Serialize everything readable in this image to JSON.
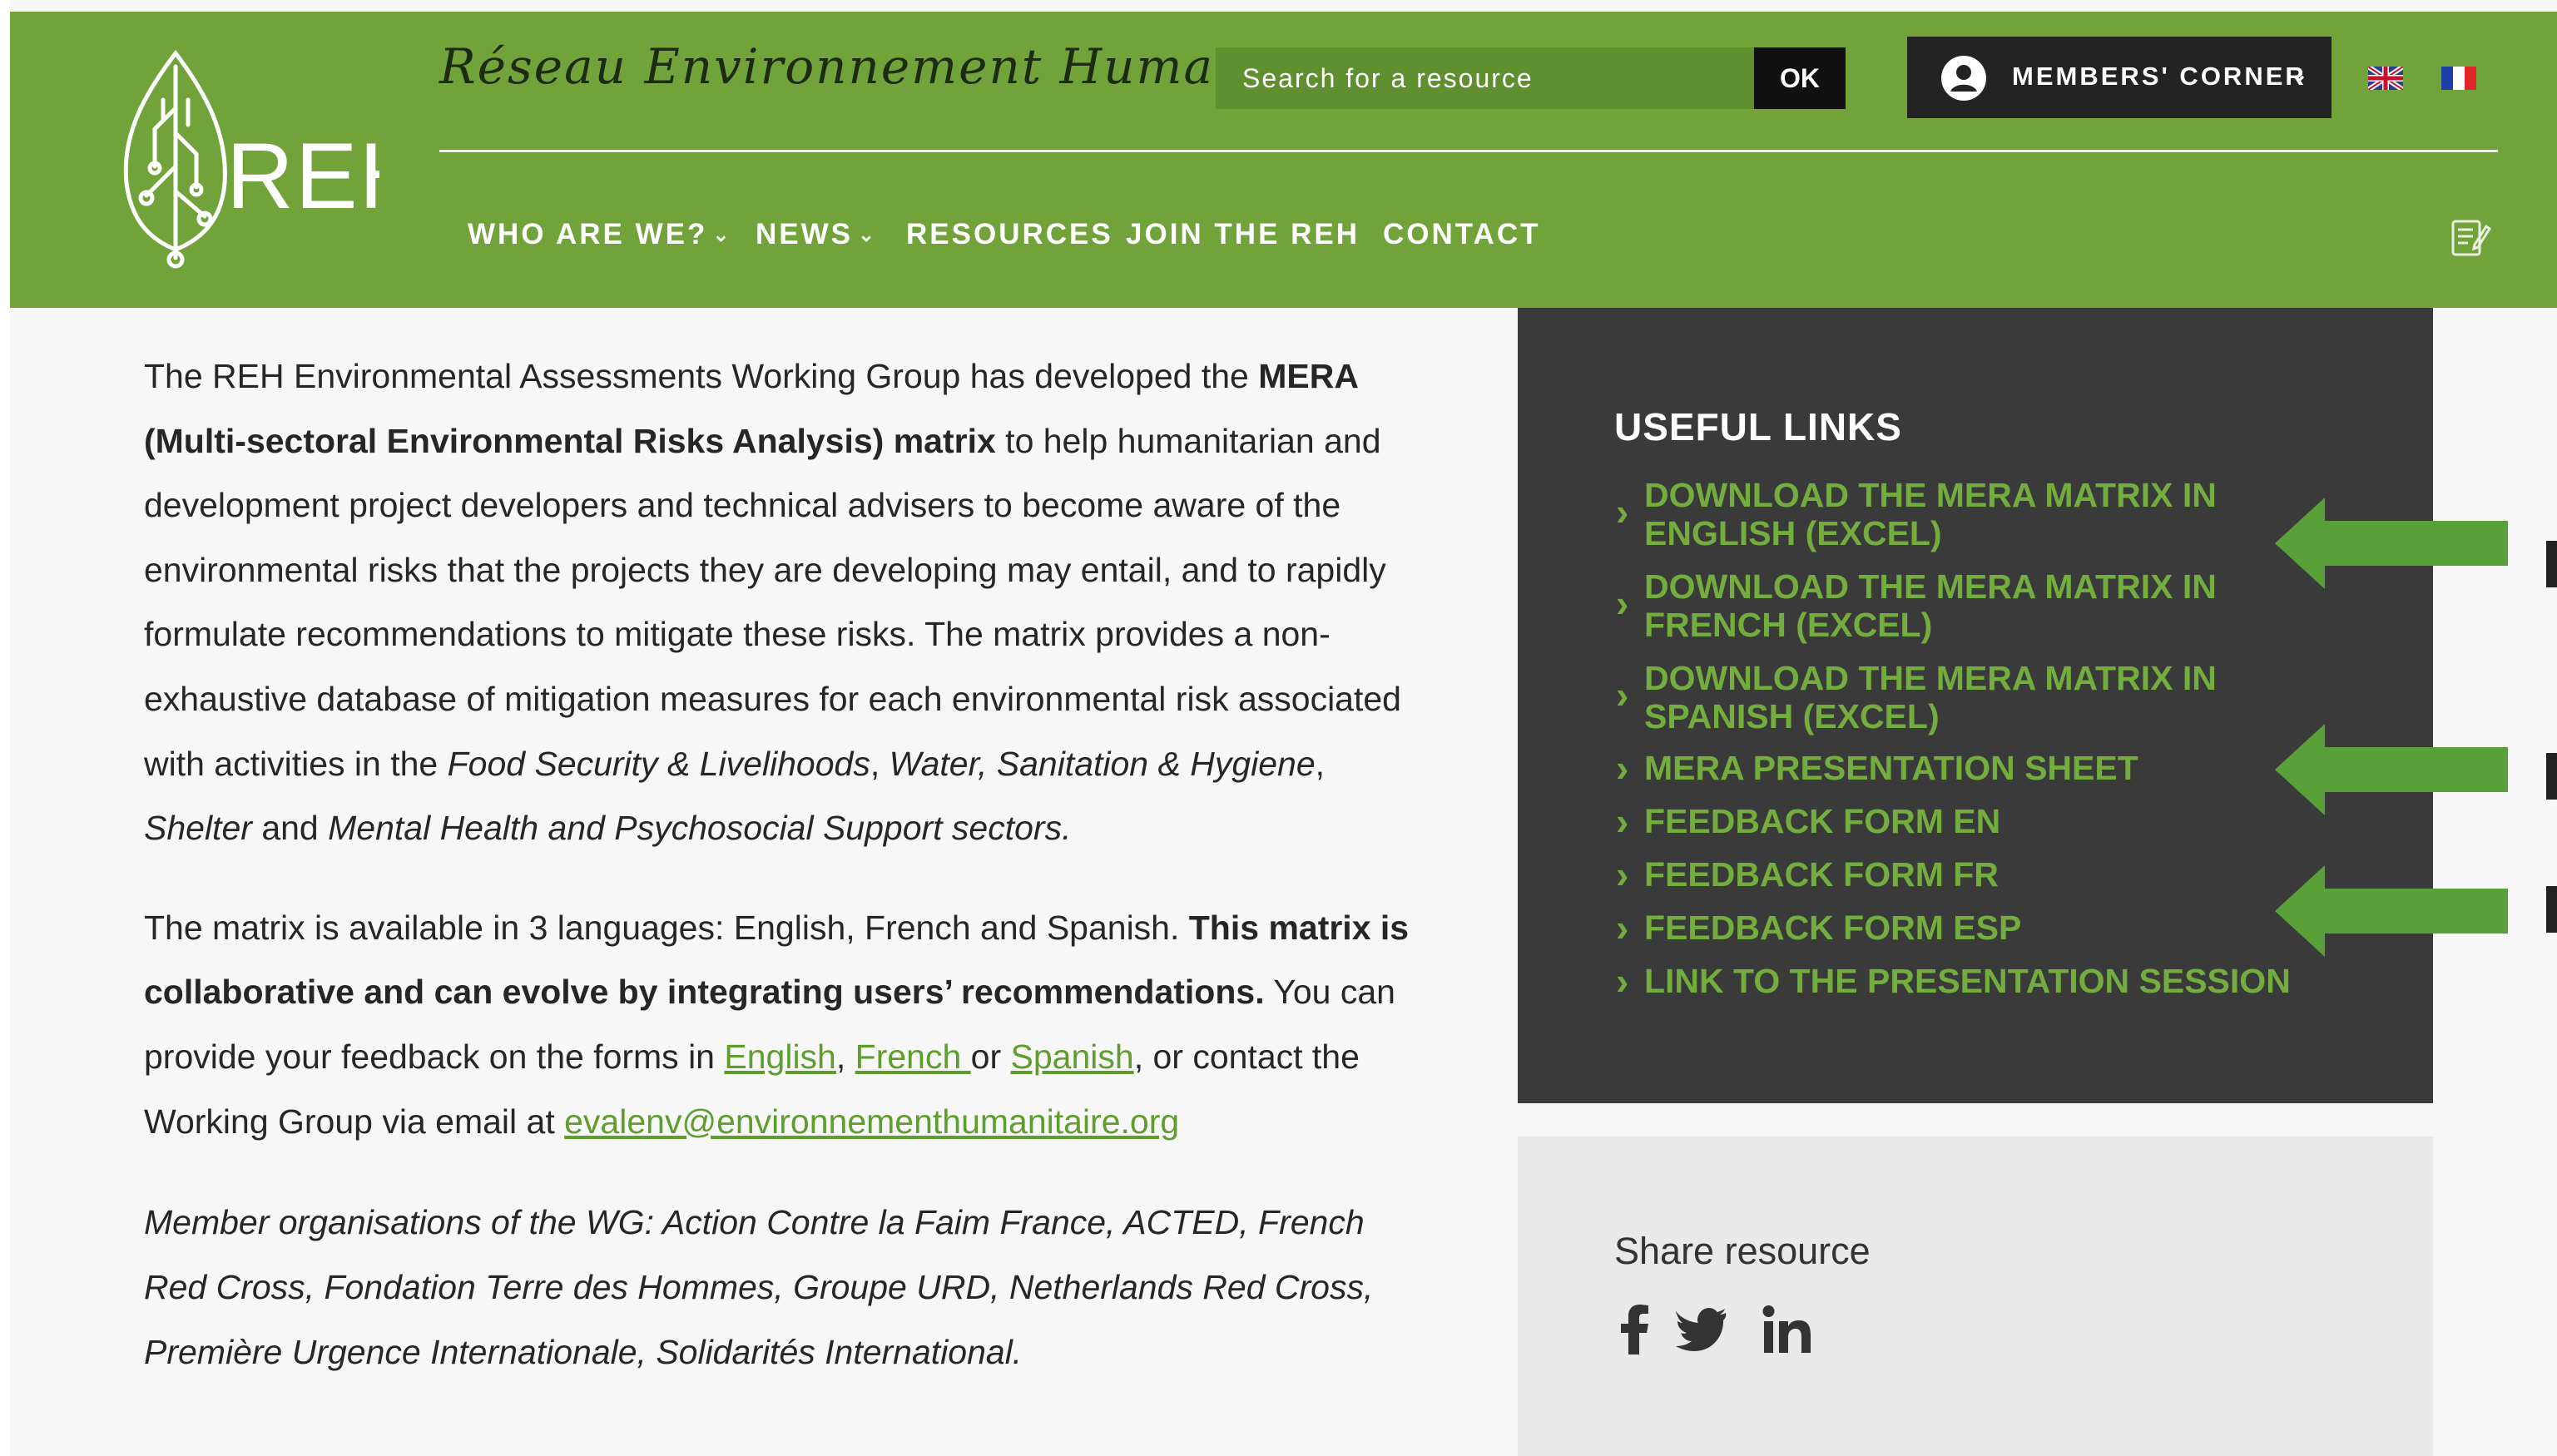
{
  "site": {
    "logo_text": "REH",
    "tagline": "Réseau Environnement Humanitaire"
  },
  "search": {
    "placeholder": "Search for a resource",
    "submit_label": "OK"
  },
  "members": {
    "label": "MEMBERS' CORNER",
    "icon": "user-circle-icon"
  },
  "languages": [
    {
      "code": "en",
      "icon": "uk-flag-icon"
    },
    {
      "code": "fr",
      "icon": "fr-flag-icon"
    }
  ],
  "nav": {
    "items": [
      {
        "label": "WHO ARE WE?",
        "has_dropdown": true
      },
      {
        "label": "NEWS",
        "has_dropdown": true
      },
      {
        "label": "RESOURCES",
        "has_dropdown": false
      },
      {
        "label": "JOIN THE REH",
        "has_dropdown": false
      },
      {
        "label": "CONTACT",
        "has_dropdown": false
      }
    ],
    "notes_icon": "notepad-icon"
  },
  "main": {
    "p1_a": "The REH Environmental Assessments Working Group has developed the ",
    "p1_b": "MERA (Multi-sectoral Environmental Risks Analysis) matrix",
    "p1_c": " to help humanitarian and development project developers and technical advisers to become aware of the environmental risks that the projects they are developing may entail, and to rapidly formulate recommendations to mitigate these risks. The matrix provides a non-exhaustive database of mitigation measures for each environmental risk associated with activities in the ",
    "p1_d": "Food Security & Livelihoods",
    "p1_e": ", ",
    "p1_f": "Water, Sanitation & Hygiene",
    "p1_g": ", ",
    "p1_h": "Shelter",
    "p1_i": " and ",
    "p1_j": "Mental Health and Psychosocial Support sectors.",
    "p2_a": "The matrix is available in 3 languages: English, French and Spanish. ",
    "p2_b": "This matrix is collaborative and can evolve by integrating users’ recommendations.",
    "p2_c": " You can provide your feedback on the forms in ",
    "link_en": "English",
    "sep1": ", ",
    "link_fr": "French ",
    "sep2": "or ",
    "link_es": "Spanish",
    "p2_d": ", or contact the Working Group via email at ",
    "email": "evalenv@environnementhumanitaire.org",
    "p3": "Member organisations of the WG: Action Contre la Faim France, ACTED, French Red Cross, Fondation Terre des Hommes, Groupe URD, Netherlands Red Cross, Première Urgence Internationale, Solidarités International."
  },
  "sidebar": {
    "title": "USEFUL LINKS",
    "links": [
      {
        "line1": "DOWNLOAD THE MERA MATRIX IN",
        "line2": "ENGLISH (EXCEL)"
      },
      {
        "line1": "DOWNLOAD THE MERA MATRIX IN",
        "line2": "FRENCH (EXCEL)"
      },
      {
        "line1": "DOWNLOAD THE MERA MATRIX IN",
        "line2": "SPANISH (EXCEL)"
      },
      {
        "line1": "MERA PRESENTATION SHEET"
      },
      {
        "line1": "FEEDBACK FORM EN"
      },
      {
        "line1": "FEEDBACK FORM FR"
      },
      {
        "line1": "FEEDBACK FORM ESP"
      },
      {
        "line1": "LINK TO THE PRESENTATION SESSION"
      }
    ],
    "share_title": "Share resource",
    "social": [
      "facebook-icon",
      "twitter-icon",
      "linkedin-icon"
    ]
  },
  "colors": {
    "header_green": "#72a33b",
    "link_green": "#73ad3e",
    "sidebar_dark": "#3a3a3a",
    "share_bg": "#e9e9e9"
  }
}
